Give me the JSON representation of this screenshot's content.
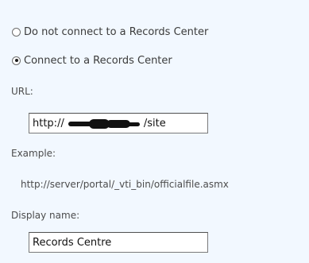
{
  "options": {
    "no_connect_label": "Do not connect to a Records Center",
    "connect_label": "Connect to a Records Center",
    "selected": "connect"
  },
  "url": {
    "label": "URL:",
    "value_prefix": "http://",
    "value_suffix": "/site"
  },
  "example": {
    "label": "Example:",
    "value": "http://server/portal/_vti_bin/officialfile.asmx"
  },
  "display_name": {
    "label": "Display name:",
    "value": "Records Centre"
  }
}
